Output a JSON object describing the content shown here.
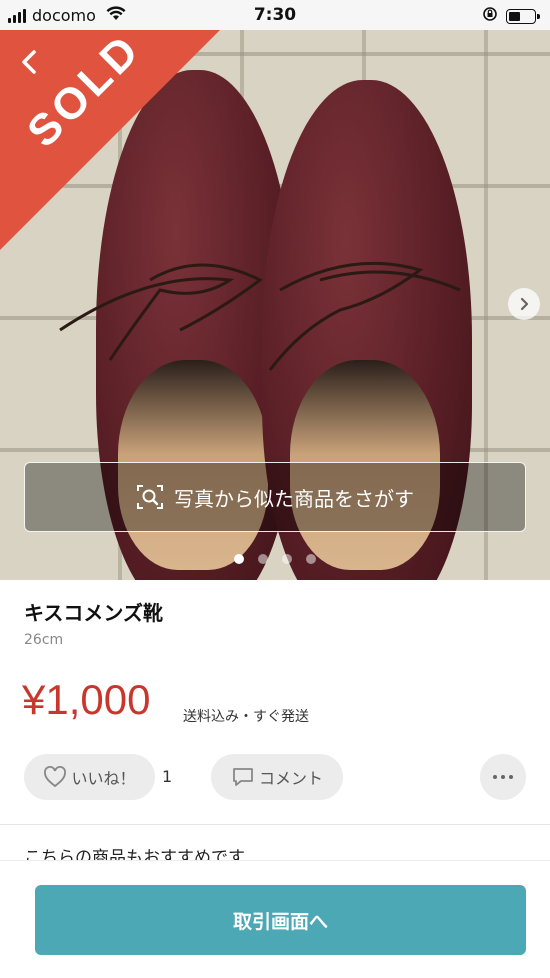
{
  "status_bar": {
    "carrier": "docomo",
    "time": "7:30"
  },
  "product_image": {
    "sold_label": "SOLD",
    "image_search_label": "写真から似た商品をさがす",
    "image_count": 4,
    "current_image_index": 1
  },
  "product": {
    "title": "キスコメンズ靴",
    "size": "26cm",
    "price": "¥1,000",
    "shipping_note": "送料込み・すぐ発送"
  },
  "actions": {
    "like_label": "いいね！",
    "like_count": "1",
    "comment_label": "コメント"
  },
  "recommend_heading": "こちらの商品もおすすめです",
  "bottom": {
    "trade_button_label": "取引画面へ"
  },
  "colors": {
    "sold": "#e0543f",
    "price": "#c8372d",
    "primary_button": "#4ba8b4"
  }
}
